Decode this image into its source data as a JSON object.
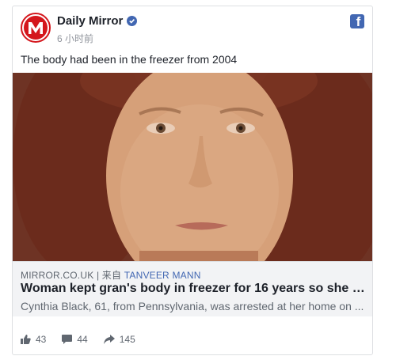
{
  "post": {
    "page_name": "Daily Mirror",
    "time": "6 小时前",
    "text": "The body had been in the freezer from 2004",
    "logo_letter": "M"
  },
  "link": {
    "domain": "MIRROR.CO.UK",
    "separator": " | 来自 ",
    "author": "TANVEER MANN",
    "title": "Woman kept gran's body in freezer for 16 years so she c...",
    "description": "Cynthia Black, 61, from Pennsylvania, was arrested at her home on ..."
  },
  "stats": {
    "likes": "43",
    "comments": "44",
    "shares": "145"
  },
  "icons": {
    "facebook": "facebook-icon",
    "verified": "verified-badge-icon",
    "like": "thumbs-up-icon",
    "comment": "comment-bubble-icon",
    "share": "share-arrow-icon"
  },
  "colors": {
    "brand_red": "#d4161c",
    "facebook_blue": "#4267b2",
    "link_bg": "#f2f3f5"
  }
}
